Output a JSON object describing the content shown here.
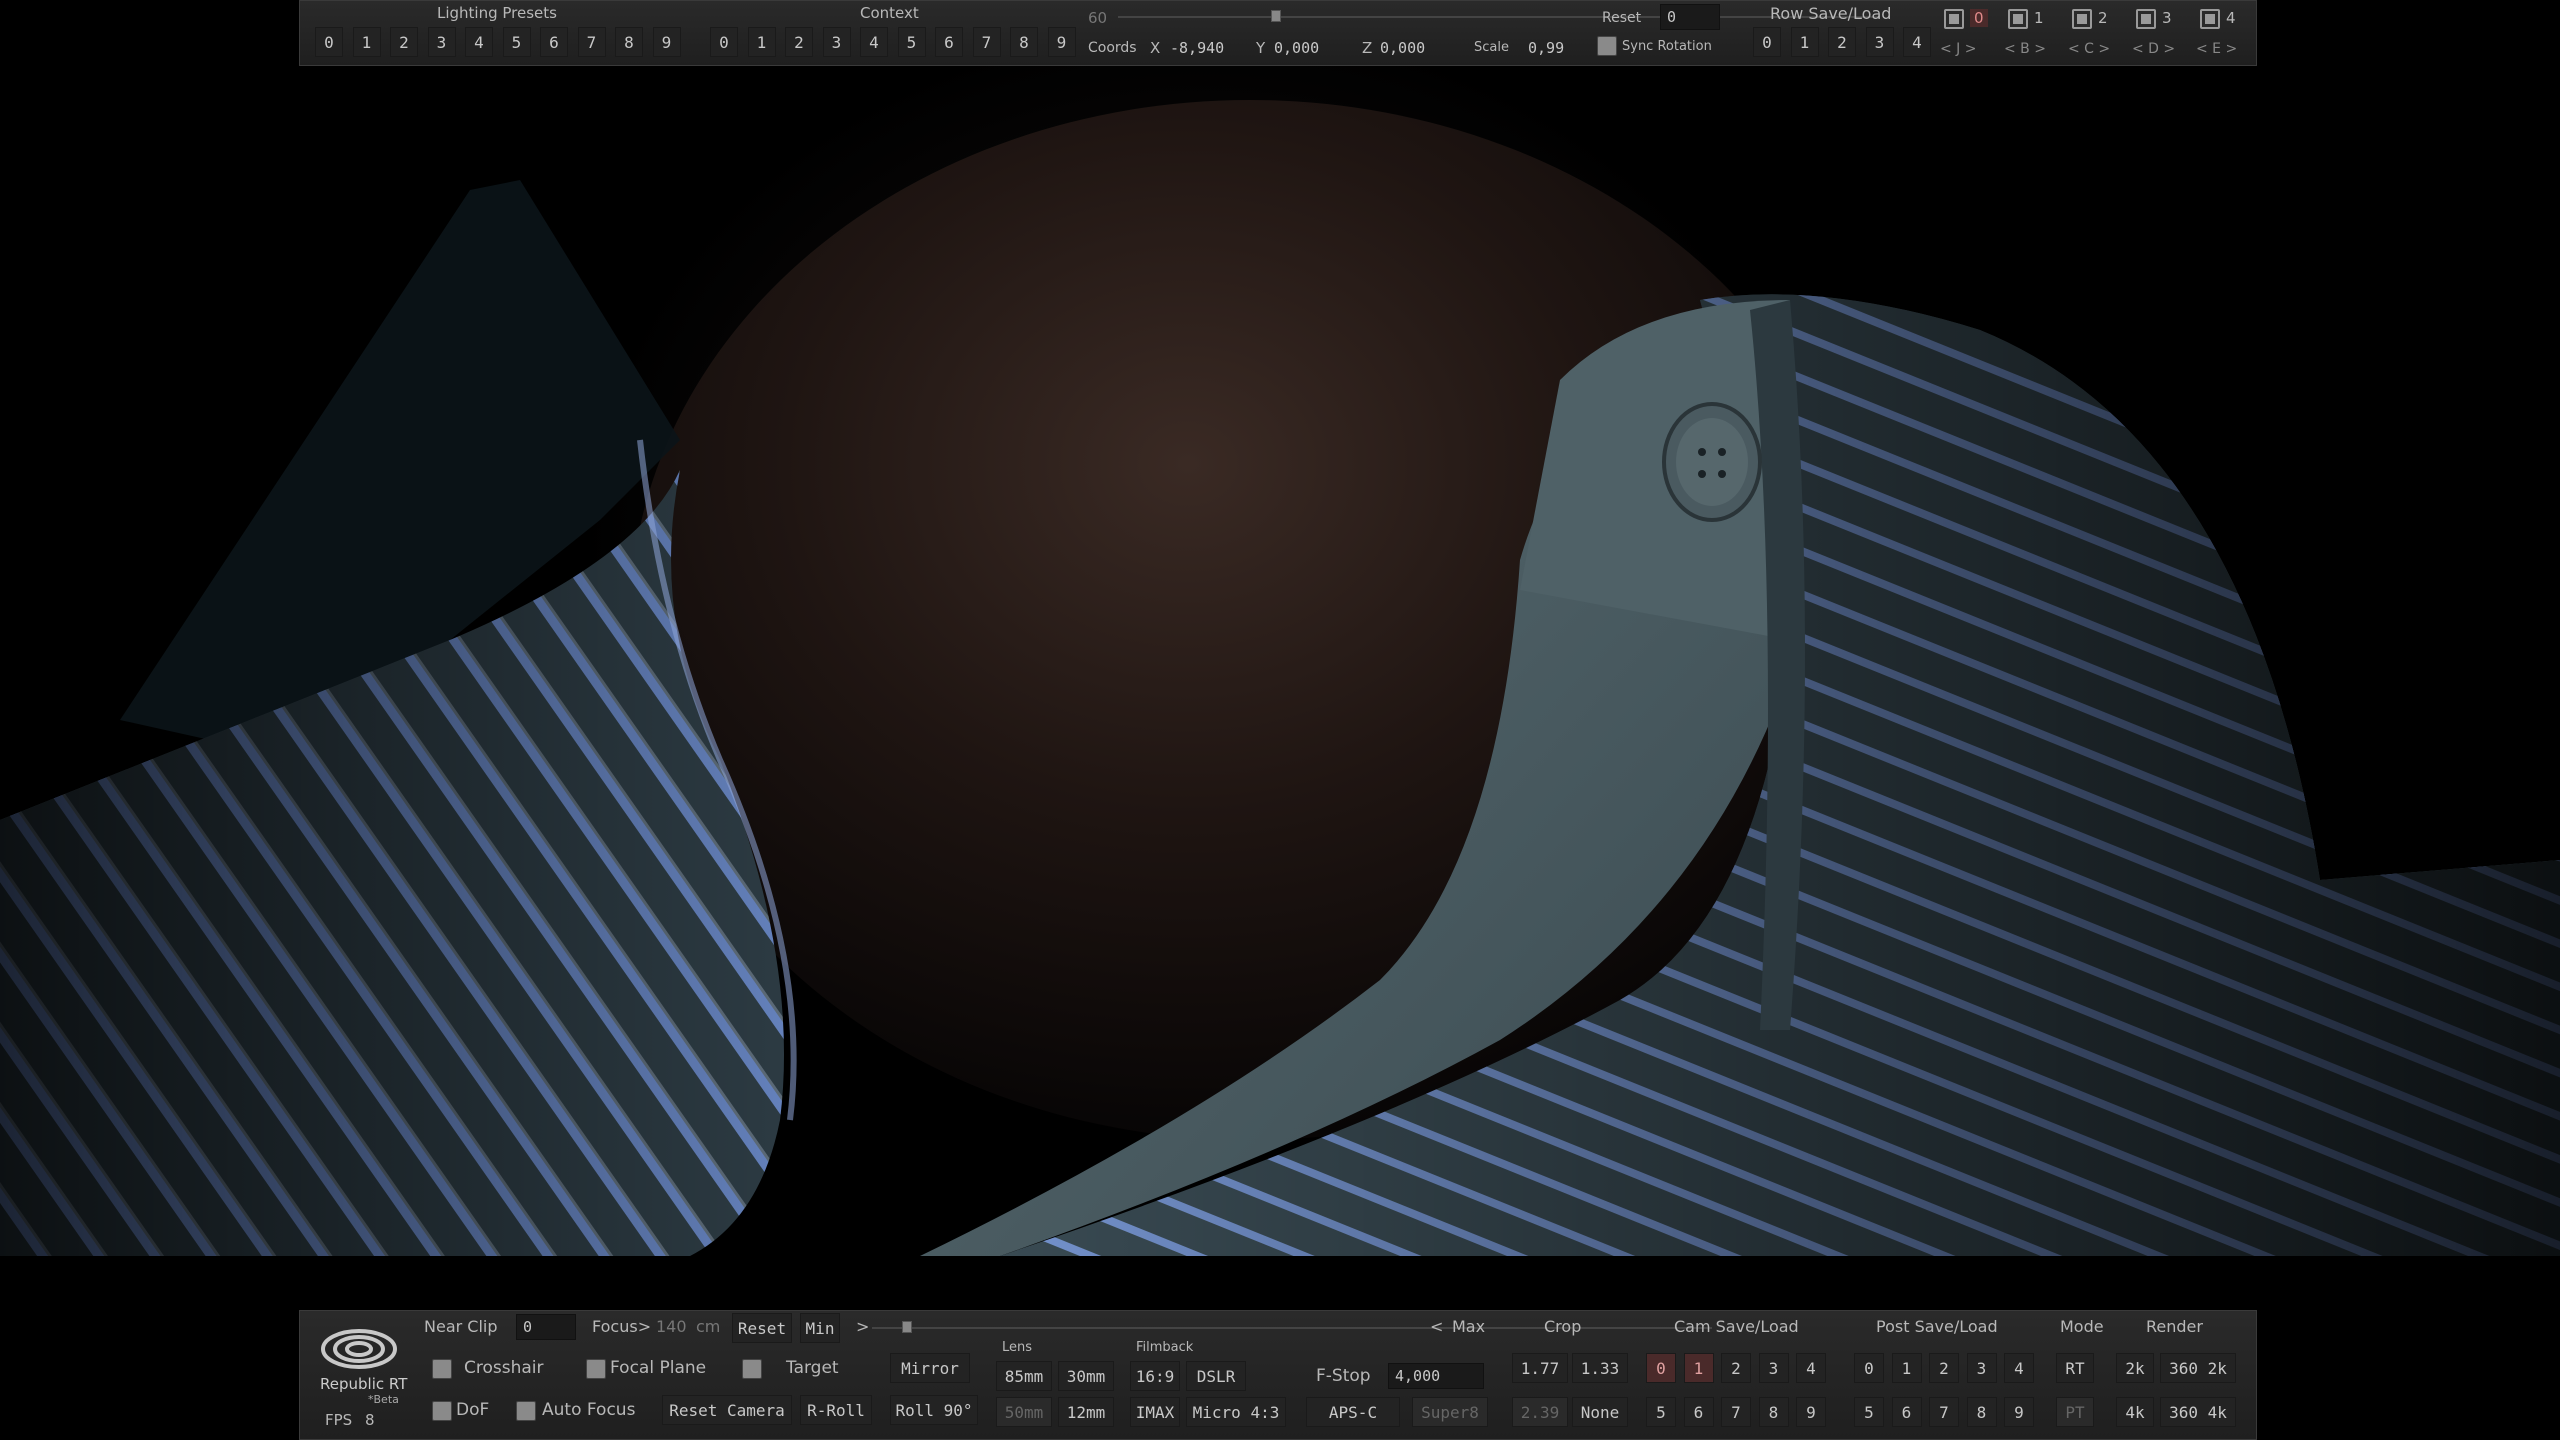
{
  "top": {
    "lighting_presets_label": "Lighting Presets",
    "lighting_presets": [
      "0",
      "1",
      "2",
      "3",
      "4",
      "5",
      "6",
      "7",
      "8",
      "9"
    ],
    "context_label": "Context",
    "context": [
      "0",
      "1",
      "2",
      "3",
      "4",
      "5",
      "6",
      "7",
      "8",
      "9"
    ],
    "slider_value": "60",
    "coords_label": "Coords",
    "x_label": "X",
    "x_value": "-8,940",
    "y_label": "Y",
    "y_value": "0,000",
    "z_label": "Z",
    "z_value": "0,000",
    "scale_label": "Scale",
    "scale_value": "0,99",
    "reset_label": "Reset",
    "reset_value": "0",
    "sync_rotation_label": "Sync Rotation",
    "row_save_load_label": "Row Save/Load",
    "row_slots": [
      "0",
      "1",
      "2",
      "3",
      "4"
    ],
    "layers": [
      {
        "label": "0",
        "nav": "< J >"
      },
      {
        "label": "1",
        "nav": "< B >"
      },
      {
        "label": "2",
        "nav": "< C >"
      },
      {
        "label": "3",
        "nav": "< D >"
      },
      {
        "label": "4",
        "nav": "< E >"
      }
    ]
  },
  "bottom": {
    "logo_text": "Republic RT",
    "logo_sub": "*Beta",
    "fps_label": "FPS",
    "fps_value": "8",
    "near_clip_label": "Near Clip",
    "near_clip_value": "0",
    "focus_label": "Focus>",
    "focus_value": "140",
    "focus_unit": "cm",
    "reset_label": "Reset",
    "min_label": "Min",
    "min_arrow": ">",
    "max_arrow": "<",
    "max_label": "Max",
    "crosshair": "Crosshair",
    "focal_plane": "Focal Plane",
    "target": "Target",
    "mirror": "Mirror",
    "dof": "DoF",
    "auto_focus": "Auto Focus",
    "reset_camera": "Reset Camera",
    "r_roll": "R-Roll",
    "roll_90": "Roll 90°",
    "lens_label": "Lens",
    "lens": [
      "85mm",
      "30mm",
      "50mm",
      "12mm"
    ],
    "filmback_label": "Filmback",
    "filmback": [
      "16:9",
      "DSLR",
      "IMAX",
      "Micro 4:3",
      "APS-C",
      "Super8"
    ],
    "fstop_label": "F-Stop",
    "fstop_value": "4,000",
    "crop_label": "Crop",
    "crop": [
      "1.77",
      "1.33",
      "2.39",
      "None"
    ],
    "cam_save_load_label": "Cam Save/Load",
    "cam_slots_row1": [
      "0",
      "1",
      "2",
      "3",
      "4"
    ],
    "cam_slots_row2": [
      "5",
      "6",
      "7",
      "8",
      "9"
    ],
    "post_save_load_label": "Post Save/Load",
    "post_slots_row1": [
      "0",
      "1",
      "2",
      "3",
      "4"
    ],
    "post_slots_row2": [
      "5",
      "6",
      "7",
      "8",
      "9"
    ],
    "mode_label": "Mode",
    "mode": [
      "RT",
      "PT"
    ],
    "render_label": "Render",
    "render": [
      "2k",
      "360 2k",
      "4k",
      "360 4k"
    ]
  },
  "colors": {
    "panel_bg": "#242424",
    "active_slot": "#4a2a2a",
    "shirt_stripe": "#6f8fd0",
    "shirt_base": "#3a4a52"
  }
}
